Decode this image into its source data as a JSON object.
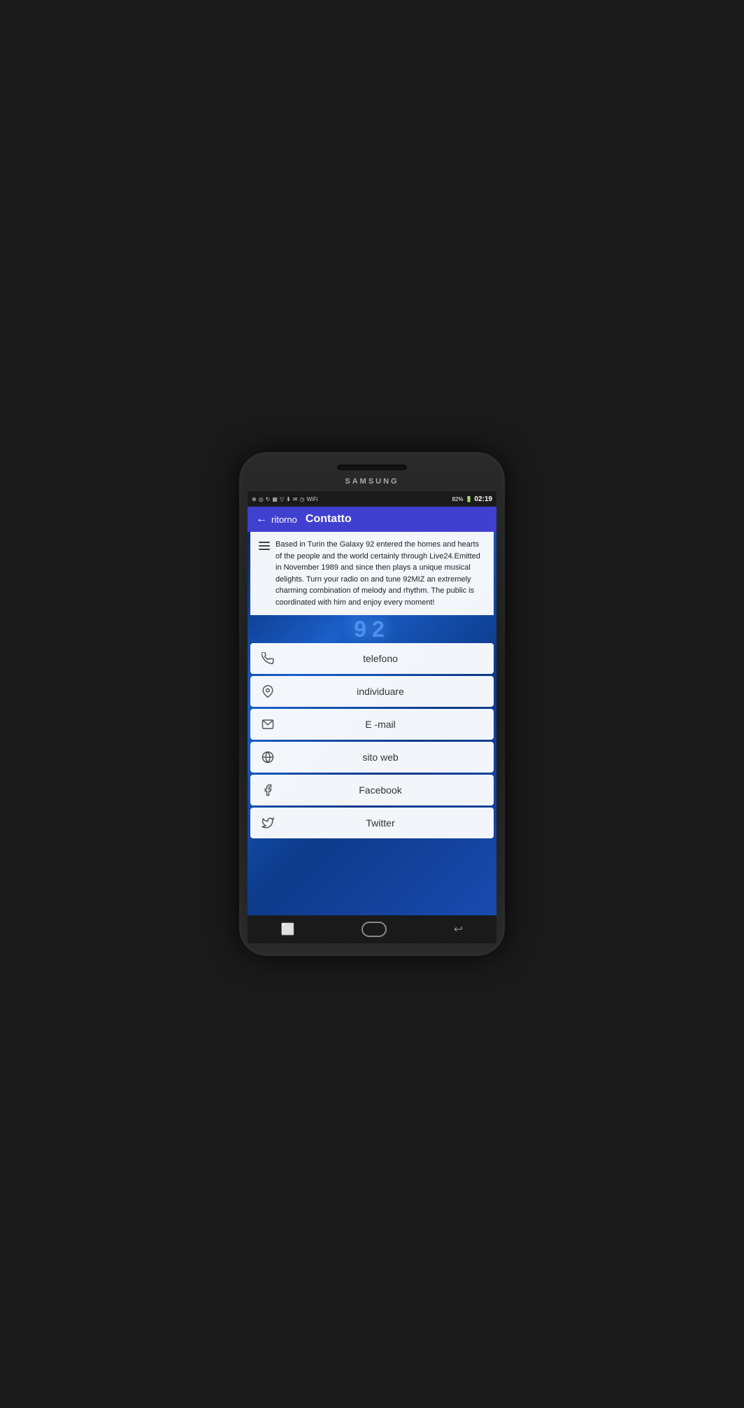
{
  "phone": {
    "brand": "SAMSUNG",
    "status_bar": {
      "time": "02:19",
      "battery": "82%"
    }
  },
  "app_bar": {
    "back_label": "ritorno",
    "title": "Contatto"
  },
  "description": {
    "text": "Based in Turin the Galaxy 92 entered the homes and hearts of the people and the world certainly through Live24.Emitted in November 1989 and since then plays a unique musical delights. Turn your radio on and tune 92MIZ an extremely charming combination of melody and rhythm. The public is coordinated with him and enjoy every moment!"
  },
  "logo": {
    "text": "92"
  },
  "contact_buttons": [
    {
      "id": "telefono",
      "label": "telefono",
      "icon": "phone"
    },
    {
      "id": "individuare",
      "label": "individuare",
      "icon": "location"
    },
    {
      "id": "email",
      "label": "E -mail",
      "icon": "email"
    },
    {
      "id": "sito-web",
      "label": "sito web",
      "icon": "globe"
    },
    {
      "id": "facebook",
      "label": "Facebook",
      "icon": "facebook"
    },
    {
      "id": "twitter",
      "label": "Twitter",
      "icon": "twitter"
    }
  ]
}
